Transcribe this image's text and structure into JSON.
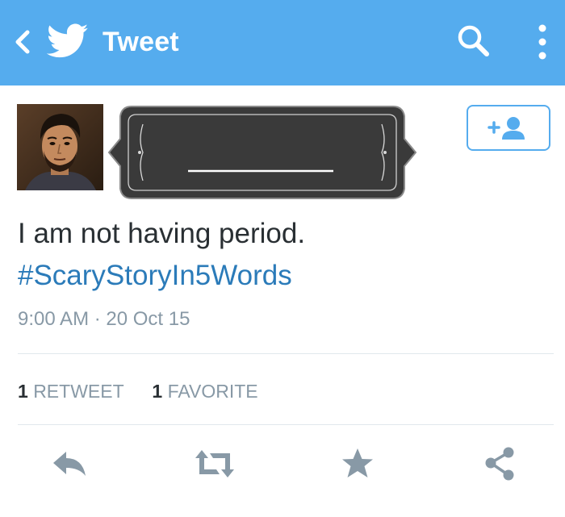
{
  "header": {
    "title": "Tweet",
    "back_icon": "chevron-left-icon",
    "logo_icon": "twitter-bird-icon",
    "search_icon": "search-icon",
    "more_icon": "more-vertical-icon",
    "background_color": "#55acee"
  },
  "tweet": {
    "text": "I am not having period.",
    "hashtag": "#ScaryStoryIn5Words",
    "timestamp": "9:00 AM · 20 Oct 15",
    "follow_icon": "add-user-icon"
  },
  "stats": {
    "retweets_count": "1",
    "retweets_label": "RETWEET",
    "favorites_count": "1",
    "favorites_label": "FAVORITE"
  },
  "actions": {
    "reply_icon": "reply-icon",
    "retweet_icon": "retweet-icon",
    "favorite_icon": "star-icon",
    "share_icon": "share-icon"
  },
  "colors": {
    "accent": "#55acee",
    "link": "#2b7bb9",
    "muted": "#8899a6",
    "icon": "#8899a6"
  }
}
